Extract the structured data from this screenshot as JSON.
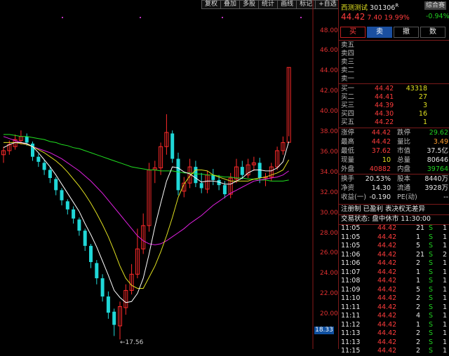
{
  "toolbar": [
    "复权",
    "叠加",
    "多股",
    "统计",
    "画线",
    "标记",
    "+自选",
    "返回"
  ],
  "y_axis_labels": [
    "48.00",
    "46.00",
    "44.00",
    "42.00",
    "40.00",
    "38.00",
    "36.00",
    "34.00",
    "32.00",
    "30.00",
    "28.00",
    "26.00",
    "24.00",
    "22.00",
    "20.00"
  ],
  "current_price_tag": "18.33",
  "low_label": "←17.56",
  "stock": {
    "name": "西测测试",
    "code": "301306",
    "flag": "R",
    "price": "44.42",
    "change": "7.40",
    "pct": "19.99%",
    "index_name": "综合赛",
    "index_pct": "-0.94%"
  },
  "trade_buttons": {
    "buy": "买",
    "sell": "卖",
    "cancel": "撤",
    "query": "数"
  },
  "order_book": {
    "asks": [
      "卖五",
      "卖四",
      "卖三",
      "卖二",
      "卖一"
    ],
    "bids": [
      {
        "label": "买一",
        "price": "44.42",
        "vol": "43318"
      },
      {
        "label": "买二",
        "price": "44.41",
        "vol": "27"
      },
      {
        "label": "买三",
        "price": "44.39",
        "vol": "3"
      },
      {
        "label": "买四",
        "price": "44.30",
        "vol": "16"
      },
      {
        "label": "买五",
        "price": "44.22",
        "vol": "1"
      }
    ]
  },
  "stats": [
    {
      "l1": "涨停",
      "v1": "44.42",
      "l2": "跌停",
      "v2": "29.62"
    },
    {
      "l1": "最高",
      "v1": "44.42",
      "l2": "量比",
      "v2": "3.49"
    },
    {
      "l1": "最低",
      "v1": "37.62",
      "l2": "市值",
      "v2": "37.5亿"
    },
    {
      "l1": "现量",
      "v1": "10",
      "l2": "总量",
      "v2": "80646"
    },
    {
      "l1": "外盘",
      "v1": "40882",
      "l2": "内盘",
      "v2": "39764"
    }
  ],
  "stats2": [
    {
      "l1": "换手",
      "v1": "20.53%",
      "l2": "股本",
      "v2": "8440万"
    },
    {
      "l1": "净资",
      "v1": "14.30",
      "l2": "流通",
      "v2": "3928万"
    },
    {
      "l1": "收益(一)",
      "v1": "-0.190",
      "l2": "PE(动)",
      "v2": "--"
    }
  ],
  "note": "注册制 已盈利 表决权无差异",
  "trade_status": "交易状态: 盘中休市 11:30:00",
  "ticks": [
    {
      "time": "11:05",
      "price": "44.42",
      "vol": "21",
      "side": "S",
      "n": "1"
    },
    {
      "time": "11:05",
      "price": "44.42",
      "vol": "1",
      "side": "S",
      "n": "1"
    },
    {
      "time": "11:05",
      "price": "44.42",
      "vol": "5",
      "side": "S",
      "n": "1"
    },
    {
      "time": "11:06",
      "price": "44.42",
      "vol": "21",
      "side": "S",
      "n": "2"
    },
    {
      "time": "11:06",
      "price": "44.42",
      "vol": "2",
      "side": "S",
      "n": "1"
    },
    {
      "time": "11:07",
      "price": "44.42",
      "vol": "1",
      "side": "S",
      "n": "1"
    },
    {
      "time": "11:08",
      "price": "44.42",
      "vol": "1",
      "side": "S",
      "n": "1"
    },
    {
      "time": "11:09",
      "price": "44.42",
      "vol": "5",
      "side": "S",
      "n": "1"
    },
    {
      "time": "11:10",
      "price": "44.42",
      "vol": "2",
      "side": "S",
      "n": "1"
    },
    {
      "time": "11:11",
      "price": "44.42",
      "vol": "2",
      "side": "S",
      "n": "1"
    },
    {
      "time": "11:11",
      "price": "44.42",
      "vol": "4",
      "side": "S",
      "n": "1"
    },
    {
      "time": "11:12",
      "price": "44.42",
      "vol": "1",
      "side": "S",
      "n": "1"
    },
    {
      "time": "11:13",
      "price": "44.42",
      "vol": "2",
      "side": "S",
      "n": "1"
    },
    {
      "time": "11:13",
      "price": "44.42",
      "vol": "2",
      "side": "S",
      "n": "1"
    },
    {
      "time": "11:15",
      "price": "44.42",
      "vol": "2",
      "side": "S",
      "n": "1"
    }
  ],
  "chart_data": {
    "type": "candlestick",
    "y_range": [
      17,
      49
    ],
    "colors": {
      "up": "#ff2a2a",
      "down": "#20d8d8",
      "ma5": "#ffffff",
      "ma10": "#e0e020",
      "ma20": "#e020e0",
      "ma60": "#20e020"
    },
    "candles": [
      [
        35.8,
        36.2,
        35.0,
        36.6
      ],
      [
        36.2,
        36.8,
        35.8,
        37.2
      ],
      [
        36.6,
        37.3,
        36.3,
        37.8
      ],
      [
        37.2,
        37.6,
        36.8,
        38.2
      ],
      [
        37.6,
        37.0,
        36.7,
        37.9
      ],
      [
        36.9,
        35.6,
        35.2,
        37.1
      ],
      [
        35.6,
        35.1,
        34.6,
        35.9
      ],
      [
        35.0,
        34.3,
        33.8,
        35.3
      ],
      [
        34.3,
        33.5,
        33.0,
        34.6
      ],
      [
        33.4,
        32.3,
        31.8,
        33.6
      ],
      [
        32.3,
        31.3,
        30.8,
        32.5
      ],
      [
        31.2,
        30.4,
        29.9,
        31.4
      ],
      [
        30.4,
        29.5,
        29.0,
        30.7
      ],
      [
        29.4,
        28.3,
        27.8,
        29.6
      ],
      [
        28.3,
        26.8,
        26.3,
        28.5
      ],
      [
        26.8,
        25.2,
        24.6,
        27.0
      ],
      [
        25.1,
        23.6,
        23.0,
        25.4
      ],
      [
        23.6,
        21.8,
        21.3,
        24.0
      ],
      [
        21.8,
        20.2,
        19.6,
        22.3
      ],
      [
        20.3,
        19.0,
        17.9,
        20.6
      ],
      [
        18.9,
        20.8,
        17.56,
        21.3
      ],
      [
        20.7,
        22.4,
        20.0,
        23.0
      ],
      [
        22.4,
        24.0,
        22.0,
        25.0
      ],
      [
        24.0,
        26.5,
        23.6,
        28.5
      ],
      [
        26.5,
        28.8,
        26.0,
        30.0
      ],
      [
        28.8,
        34.3,
        28.2,
        35.0
      ],
      [
        34.3,
        34.5,
        33.0,
        35.2
      ],
      [
        34.5,
        36.6,
        33.8,
        37.0
      ],
      [
        36.6,
        38.0,
        35.8,
        39.8
      ],
      [
        37.9,
        35.4,
        35.0,
        38.2
      ],
      [
        35.4,
        32.3,
        31.8,
        36.0
      ],
      [
        32.2,
        33.0,
        31.6,
        33.6
      ],
      [
        33.0,
        34.6,
        32.5,
        35.4
      ],
      [
        34.6,
        33.0,
        32.6,
        35.2
      ],
      [
        33.0,
        32.5,
        32.0,
        34.0
      ],
      [
        32.4,
        33.8,
        32.0,
        34.2
      ],
      [
        33.8,
        33.3,
        32.8,
        34.4
      ],
      [
        33.3,
        32.8,
        32.3,
        33.8
      ],
      [
        32.8,
        31.9,
        31.5,
        33.2
      ],
      [
        31.9,
        33.5,
        31.5,
        34.0
      ],
      [
        33.4,
        34.6,
        33.0,
        35.4
      ],
      [
        34.6,
        33.8,
        33.4,
        35.2
      ],
      [
        33.8,
        34.8,
        33.5,
        35.4
      ],
      [
        34.8,
        35.0,
        34.2,
        35.6
      ],
      [
        35.0,
        33.5,
        33.0,
        35.5
      ],
      [
        33.5,
        33.6,
        32.7,
        34.0
      ],
      [
        33.6,
        34.6,
        33.2,
        35.0
      ],
      [
        34.6,
        36.2,
        34.3,
        36.6
      ],
      [
        36.2,
        37.0,
        35.8,
        37.6
      ],
      [
        37.02,
        44.42,
        37.62,
        44.42
      ]
    ],
    "ma5": [
      36.5,
      36.8,
      37.0,
      37.0,
      36.9,
      36.6,
      36.0,
      35.3,
      34.6,
      33.8,
      32.9,
      32.0,
      31.1,
      30.2,
      29.0,
      27.9,
      26.7,
      25.3,
      23.9,
      22.4,
      21.7,
      21.2,
      21.3,
      22.1,
      23.6,
      26.0,
      28.7,
      31.0,
      33.2,
      34.6,
      34.5,
      34.1,
      33.9,
      33.5,
      33.1,
      33.2,
      33.2,
      33.1,
      32.9,
      32.9,
      33.2,
      33.5,
      34.0,
      34.3,
      34.3,
      34.2,
      34.2,
      34.5,
      35.1,
      37.1
    ],
    "ma10": [
      37.0,
      37.0,
      37.0,
      36.9,
      36.8,
      36.6,
      36.3,
      36.0,
      35.6,
      35.2,
      34.7,
      34.1,
      33.4,
      32.7,
      31.9,
      31.0,
      30.0,
      28.9,
      27.7,
      26.3,
      24.8,
      23.6,
      22.9,
      22.6,
      22.6,
      23.7,
      24.8,
      26.2,
      27.8,
      29.6,
      31.6,
      32.9,
      33.7,
      34.3,
      34.3,
      34.2,
      33.8,
      33.6,
      33.4,
      33.2,
      33.2,
      33.2,
      33.2,
      33.4,
      33.5,
      33.6,
      33.8,
      34.0,
      34.3,
      35.3
    ],
    "ma20": [
      37.6,
      37.4,
      37.2,
      37.0,
      36.8,
      36.6,
      36.4,
      36.2,
      36.0,
      35.7,
      35.4,
      35.0,
      34.6,
      34.2,
      33.7,
      33.2,
      32.6,
      32.0,
      31.3,
      30.6,
      29.9,
      29.2,
      28.5,
      27.8,
      27.3,
      27.0,
      26.9,
      27.0,
      27.3,
      27.7,
      28.1,
      28.5,
      29.0,
      29.4,
      29.8,
      30.3,
      30.8,
      31.2,
      31.6,
      32.0,
      32.3,
      32.6,
      32.9,
      33.2,
      33.3,
      33.4,
      33.5,
      33.6,
      33.8,
      34.2
    ],
    "ma60": [
      37.8,
      37.8,
      37.7,
      37.6,
      37.6,
      37.5,
      37.4,
      37.3,
      37.1,
      37.0,
      36.8,
      36.7,
      36.5,
      36.4,
      36.2,
      36.0,
      35.8,
      35.6,
      35.4,
      35.2,
      35.0,
      34.8,
      34.6,
      34.5,
      34.4,
      34.3,
      34.3,
      34.2,
      34.2,
      34.2,
      34.1,
      34.0,
      34.0,
      33.9,
      33.9,
      33.8,
      33.8,
      33.7,
      33.6,
      33.6,
      33.5,
      33.5,
      33.4,
      33.4,
      33.3,
      33.3,
      33.2,
      33.2,
      33.2,
      33.3
    ]
  }
}
